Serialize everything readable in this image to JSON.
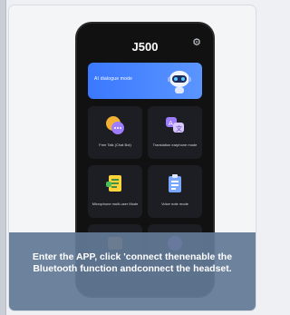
{
  "phone": {
    "title": "J500",
    "banner_label": "AI dialogue mode",
    "tiles": [
      {
        "label": "Free Talk (Chat Bot)"
      },
      {
        "label": "Translation earphone mode"
      },
      {
        "label": "Microphone multi-user Mode"
      },
      {
        "label": "Voice note mode"
      }
    ]
  },
  "caption": {
    "text": "Enter the APP, click 'connect thenenable the Bluetooth function andconnect the headset."
  },
  "colors": {
    "banner": "#3a78ff",
    "overlay": "#627996",
    "phone_bg": "#111111"
  }
}
